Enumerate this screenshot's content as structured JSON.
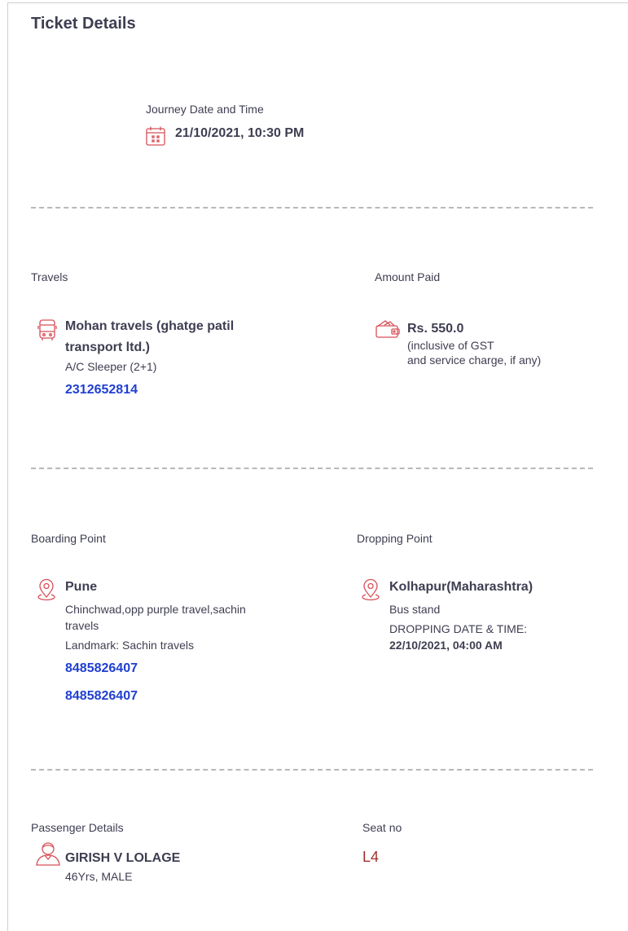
{
  "page_title": "Ticket Details",
  "journey": {
    "label": "Journey Date and Time",
    "value": "21/10/2021, 10:30 PM"
  },
  "travels": {
    "label": "Travels",
    "operator_line1": "Mohan travels (ghatge patil",
    "operator_line2": "transport ltd.)",
    "bus_type": "A/C Sleeper (2+1)",
    "phone": "2312652814"
  },
  "amount": {
    "label": "Amount Paid",
    "value": "Rs. 550.0",
    "note_line1": "(inclusive of GST",
    "note_line2": "and service charge, if any)"
  },
  "boarding": {
    "label": "Boarding Point",
    "city": "Pune",
    "address_line1": "Chinchwad,opp purple travel,sachin",
    "address_line2": "travels",
    "landmark": "Landmark: Sachin travels",
    "phone1": "8485826407",
    "phone2": "8485826407"
  },
  "dropping": {
    "label": "Dropping Point",
    "city": "Kolhapur(Maharashtra)",
    "address": "Bus stand",
    "datetime_label": "DROPPING DATE & TIME:",
    "datetime_value": "22/10/2021, 04:00 AM"
  },
  "passenger": {
    "label": "Passenger Details",
    "name": "GIRISH V LOLAGE",
    "info": "46Yrs, MALE"
  },
  "seat": {
    "label": "Seat no",
    "value": "L4"
  },
  "colors": {
    "text": "#3e3e52",
    "link": "#1f3fd1",
    "icon_red": "#d84f57",
    "seat": "#a0312c",
    "divider": "#b8b8b8"
  },
  "icons": [
    "calendar-icon",
    "bus-icon",
    "wallet-icon",
    "location-pin-icon",
    "passenger-icon"
  ]
}
